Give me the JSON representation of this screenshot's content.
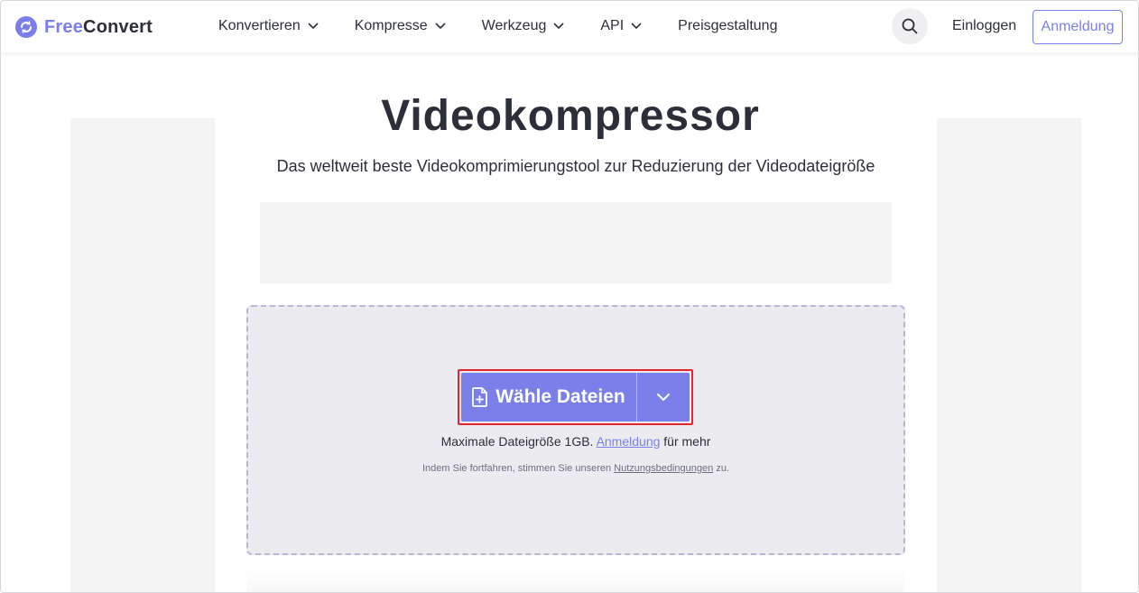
{
  "header": {
    "logo": {
      "free": "Free",
      "convert": "Convert"
    },
    "nav": [
      {
        "label": "Konvertieren"
      },
      {
        "label": "Kompresse"
      },
      {
        "label": "Werkzeug"
      },
      {
        "label": "API"
      },
      {
        "label": "Preisgestaltung"
      }
    ],
    "login_label": "Einloggen",
    "signup_label": "Anmeldung"
  },
  "main": {
    "title": "Videokompressor",
    "subtitle": "Das weltweit beste Videokomprimierungstool zur Reduzierung der Videodateigröße",
    "upload": {
      "button_label": "Wähle Dateien",
      "max_size_prefix": "Maximale Dateigröße 1GB.",
      "max_size_link": "Anmeldung",
      "max_size_suffix": "für mehr",
      "terms_prefix": "Indem Sie fortfahren, stimmen Sie unseren",
      "terms_link": "Nutzungsbedingungen",
      "terms_suffix": "zu."
    }
  },
  "colors": {
    "accent": "#7a7fea",
    "highlight_border": "#e5262e",
    "dropzone_bg": "#ebebf0"
  }
}
